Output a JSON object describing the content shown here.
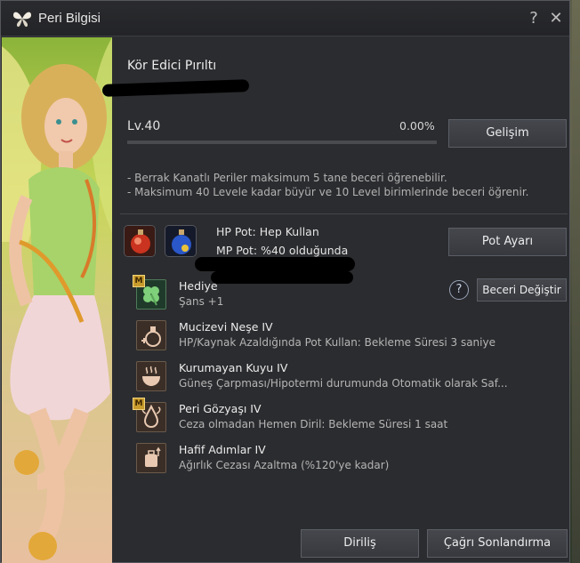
{
  "window": {
    "title": "Peri Bilgisi",
    "help": "?",
    "close": "✕"
  },
  "fairy": {
    "name": "Kör Edici Pırıltı",
    "level": "Lv.40",
    "xp_percent": "0.00%",
    "xp_fraction": 0.0,
    "grow_button": "Gelişim",
    "info_lines": [
      "- Berrak Kanatlı Periler maksimum 5 tane beceri öğrenebilir.",
      "- Maksimum 40 Levele kadar büyür ve 10 Level birimlerinde beceri öğrenir."
    ]
  },
  "potions": {
    "hp_text": "HP Pot: Hep Kullan",
    "mp_text": "MP Pot: %40 olduğunda",
    "settings_button": "Pot Ayarı"
  },
  "skills_header": {
    "help": "?",
    "change_button": "Beceri Değiştir"
  },
  "skills": [
    {
      "name": "Hediye",
      "desc": "Şans +1",
      "badge": "M",
      "icon": "clover-icon"
    },
    {
      "name": "Mucizevi Neşe IV",
      "desc": "HP/Kaynak Azaldığında Pot Kullan: Bekleme Süresi 3 saniye",
      "badge": "",
      "icon": "potion-plus-icon"
    },
    {
      "name": "Kurumayan Kuyu IV",
      "desc": "Güneş Çarpması/Hipotermi durumunda Otomatik olarak Saf...",
      "badge": "",
      "icon": "bowl-icon"
    },
    {
      "name": "Peri Gözyaşı IV",
      "desc": "Ceza olmadan Hemen Diril: Bekleme Süresi 1 saat",
      "badge": "M",
      "icon": "tear-icon"
    },
    {
      "name": "Hafif Adımlar IV",
      "desc": "Ağırlık Cezası Azaltma (%120'ye kadar)",
      "badge": "",
      "icon": "weight-icon"
    }
  ],
  "footer": {
    "revive_button": "Diriliş",
    "dismiss_button": "Çağrı Sonlandırma"
  }
}
